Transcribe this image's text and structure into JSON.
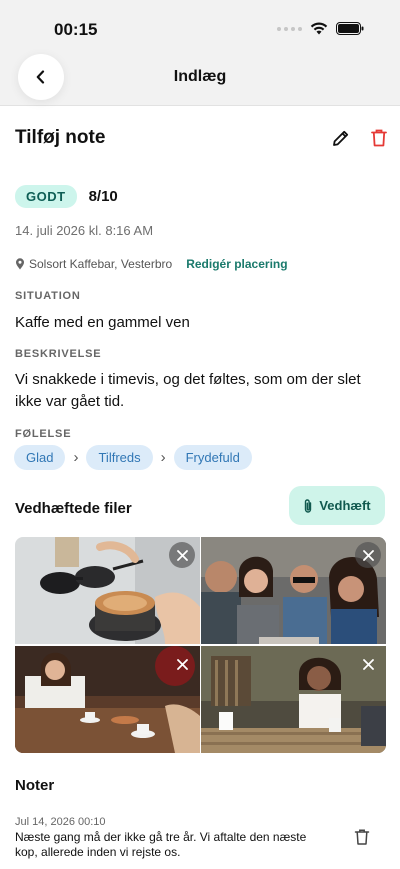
{
  "status_bar": {
    "time": "00:15"
  },
  "nav": {
    "title": "Indlæg"
  },
  "entry": {
    "title": "Tilføj note",
    "mood_label": "GODT",
    "mood_score": "8/10",
    "date": "14. juli 2026 kl. 8:16 AM",
    "location": "Solsort Kaffebar, Vesterbro",
    "edit_location_label": "Redigér placering"
  },
  "situation": {
    "label": "SITUATION",
    "text": "Kaffe med en gammel ven"
  },
  "description": {
    "label": "BESKRIVELSE",
    "text": "Vi snakkede i timevis, og det føltes, som om der slet ikke var gået tid."
  },
  "emotions": {
    "label": "FØLELSE",
    "chips": [
      "Glad",
      "Tilfreds",
      "Frydefuld"
    ]
  },
  "attachments": {
    "title": "Vedhæftede filer",
    "attach_button": "Vedhæft"
  },
  "notes": {
    "title": "Noter",
    "items": [
      {
        "date": "Jul 14, 2026 00:10",
        "text": "Næste gang må der ikke gå tre år. Vi aftalte den næste kop, allerede inden vi rejste os."
      }
    ]
  },
  "colors": {
    "accent_teal": "#1b7a6c",
    "badge_bg": "#cdf5ec",
    "chip_bg": "#dcebf9",
    "chip_text": "#3177b5",
    "delete_red": "#e53935"
  },
  "icons": [
    "back-chevron-icon",
    "pencil-icon",
    "trash-icon",
    "location-pin-icon",
    "paperclip-icon",
    "close-icon",
    "wifi-icon",
    "battery-icon"
  ]
}
